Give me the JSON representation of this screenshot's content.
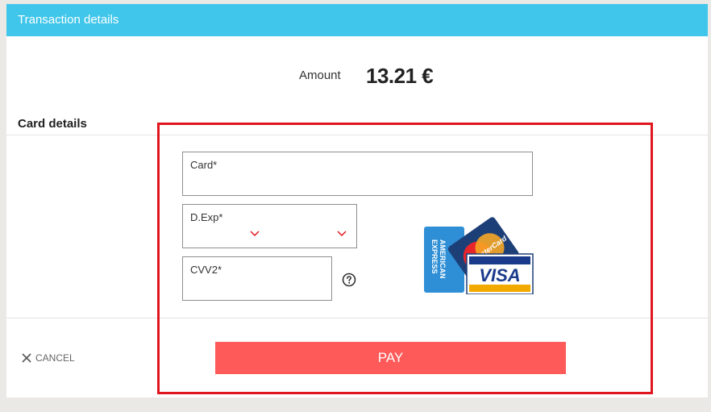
{
  "header": {
    "title": "Transaction details"
  },
  "amount": {
    "label": "Amount",
    "value": "13.21 €"
  },
  "card_details": {
    "title": "Card details",
    "card_label": "Card*",
    "expiry_label": "D.Exp*",
    "cvv_label": "CVV2*"
  },
  "card_logos": {
    "visa_text": "VISA",
    "amex_text": "AMERICAN EXPRESS",
    "mastercard_text": "MasterCard"
  },
  "actions": {
    "cancel_label": "CANCEL",
    "pay_label": "PAY"
  },
  "icons": {
    "expiry_month": "chevron-down-icon",
    "expiry_year": "chevron-down-icon",
    "cvv_help": "question-circle-icon",
    "cancel": "close-icon"
  },
  "colors": {
    "header": "#3fc6ea",
    "pay_button": "#ff5a5a",
    "highlight": "#e0161f",
    "chevron": "#e0161f"
  }
}
